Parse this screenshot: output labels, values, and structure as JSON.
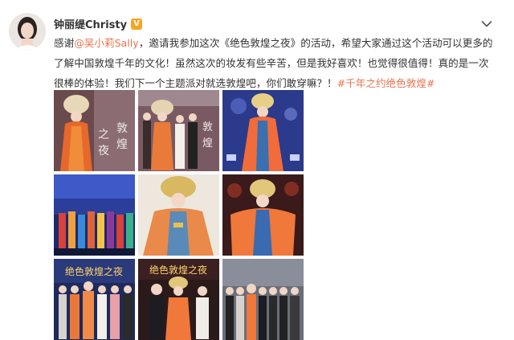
{
  "post": {
    "author": "钟丽缇Christy",
    "verified_badge": "V",
    "text_parts": [
      {
        "text": "感谢",
        "type": "plain"
      },
      {
        "text": "@吴小莉Sally",
        "type": "mention"
      },
      {
        "text": "，邀请我参加这次《绝色敦煌之夜》的活动，希望大家通过这个活动可以更多的了解中国敦煌千年的文化！虽然这次的妆发有些辛苦，但是我好喜欢！也觉得很值得！真的是一次很棒的体验！我们下一个主题派对就选敦煌吧，你们敢穿嘛？！",
        "type": "plain"
      },
      {
        "text": "#千年之约绝色敦煌#",
        "type": "hashtag"
      }
    ],
    "photos": [
      {
        "name": "photo-1",
        "text1": "之",
        "text2": "敦",
        "text3": "夜",
        "text4": "煌"
      },
      {
        "name": "photo-2",
        "text1": "敦",
        "text2": "煌"
      },
      {
        "name": "photo-3"
      },
      {
        "name": "photo-4"
      },
      {
        "name": "photo-5"
      },
      {
        "name": "photo-6"
      },
      {
        "name": "photo-7",
        "banner": "绝色敦煌之夜"
      },
      {
        "name": "photo-8",
        "banner": "绝色敦煌之夜"
      },
      {
        "name": "photo-9"
      }
    ]
  },
  "colors": {
    "accent": "#eb7350",
    "badge": "#f5a623",
    "text": "#333333"
  },
  "icons": {
    "verified": "verified-badge-icon",
    "menu": "chevron-down-icon"
  }
}
